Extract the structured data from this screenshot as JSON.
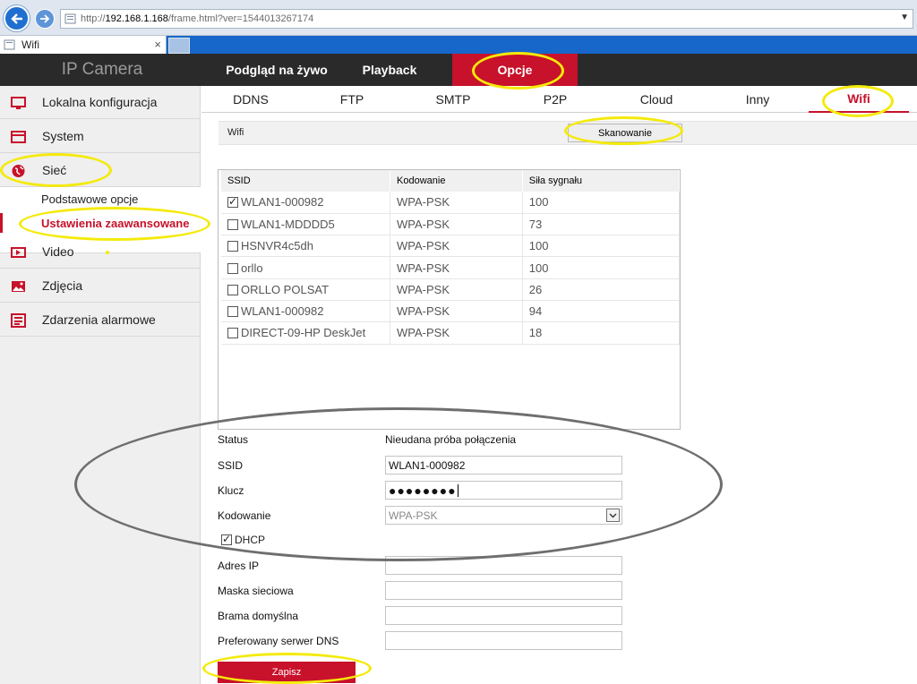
{
  "browser": {
    "url_prefix": "http://",
    "url_host": "192.168.1.168",
    "url_rest": "/frame.html?ver=1544013267174",
    "tab_title": "Wifi",
    "tab_close": "×"
  },
  "header": {
    "brand": "IP Camera",
    "nav": [
      {
        "label": "Podgląd na żywo"
      },
      {
        "label": "Playback"
      },
      {
        "label": "Opcje",
        "active": true
      }
    ]
  },
  "sidebar": {
    "items": [
      {
        "label": "Lokalna konfiguracja",
        "icon": "monitor-icon"
      },
      {
        "label": "System",
        "icon": "system-icon"
      },
      {
        "label": "Sieć",
        "icon": "globe-icon"
      },
      {
        "label": "Video",
        "icon": "video-icon"
      },
      {
        "label": "Zdjęcia",
        "icon": "image-icon"
      },
      {
        "label": "Zdarzenia alarmowe",
        "icon": "alarm-list-icon"
      }
    ],
    "subitems": [
      {
        "label": "Podstawowe opcje"
      },
      {
        "label": "Ustawienia zaawansowane",
        "active": true
      }
    ]
  },
  "subtabs": [
    {
      "label": "DDNS"
    },
    {
      "label": "FTP"
    },
    {
      "label": "SMTP"
    },
    {
      "label": "P2P"
    },
    {
      "label": "Cloud"
    },
    {
      "label": "Inny"
    },
    {
      "label": "Wifi",
      "active": true
    }
  ],
  "wifi": {
    "section_title": "Wifi",
    "scan_label": "Skanowanie",
    "table": {
      "headers": [
        "SSID",
        "Kodowanie",
        "Siła sygnału"
      ],
      "rows": [
        {
          "ssid": "WLAN1-000982",
          "enc": "WPA-PSK",
          "signal": "100",
          "checked": true
        },
        {
          "ssid": "WLAN1-MDDDD5",
          "enc": "WPA-PSK",
          "signal": "73",
          "checked": false
        },
        {
          "ssid": "HSNVR4c5dh",
          "enc": "WPA-PSK",
          "signal": "100",
          "checked": false
        },
        {
          "ssid": "orllo",
          "enc": "WPA-PSK",
          "signal": "100",
          "checked": false
        },
        {
          "ssid": "ORLLO POLSAT",
          "enc": "WPA-PSK",
          "signal": "26",
          "checked": false
        },
        {
          "ssid": "WLAN1-000982",
          "enc": "WPA-PSK",
          "signal": "94",
          "checked": false
        },
        {
          "ssid": "DIRECT-09-HP DeskJet",
          "enc": "WPA-PSK",
          "signal": "18",
          "checked": false
        }
      ]
    },
    "form": {
      "status_label": "Status",
      "status_value": "Nieudana próba połączenia",
      "ssid_label": "SSID",
      "ssid_value": "WLAN1-000982",
      "key_label": "Klucz",
      "key_value": "●●●●●●●●",
      "encoding_label": "Kodowanie",
      "encoding_value": "WPA-PSK",
      "dhcp_label": "DHCP",
      "dhcp_checked": true,
      "ip_label": "Adres IP",
      "ip_value": "",
      "mask_label": "Maska sieciowa",
      "mask_value": "",
      "gateway_label": "Brama domyślna",
      "gateway_value": "",
      "dns_label": "Preferowany serwer DNS",
      "dns_value": ""
    },
    "save_label": "Zapisz"
  },
  "colors": {
    "accent": "#c8112b",
    "annotation_yellow": "#f4ea0a",
    "annotation_gray": "#6e6e6e"
  }
}
